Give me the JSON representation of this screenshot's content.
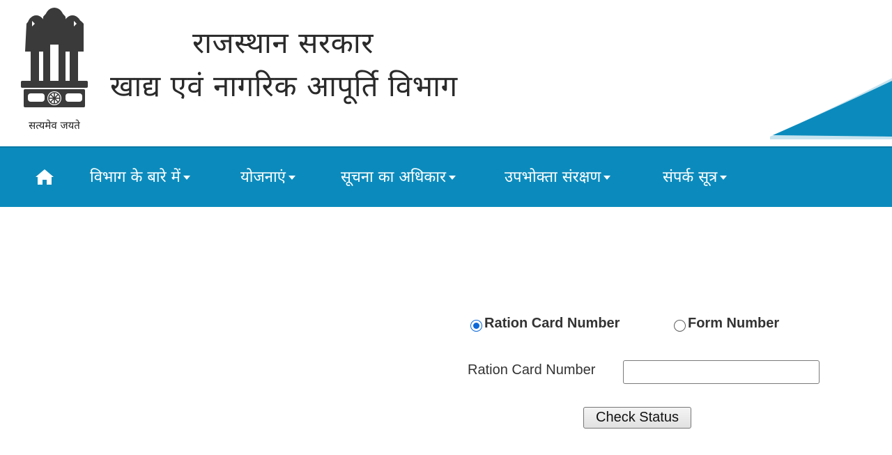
{
  "header": {
    "title_line1": "राजस्थान सरकार",
    "title_line2": "खाद्य एवं नागरिक आपूर्ति विभाग",
    "motto": "सत्यमेव जयते",
    "emblem_icon": "ashoka-emblem-icon"
  },
  "nav": {
    "home_icon": "home-icon",
    "items": [
      {
        "label": "विभाग के बारे में",
        "has_dropdown": true
      },
      {
        "label": "योजनाएं",
        "has_dropdown": true
      },
      {
        "label": "सूचना का अधिकार",
        "has_dropdown": true
      },
      {
        "label": "उपभोक्ता संरक्षण",
        "has_dropdown": true
      },
      {
        "label": "संपर्क सूत्र",
        "has_dropdown": true
      }
    ]
  },
  "form": {
    "options": [
      {
        "label": "Ration Card Number",
        "selected": true
      },
      {
        "label": "Form Number",
        "selected": false
      }
    ],
    "field_label": "Ration Card Number",
    "field_value": "",
    "field_placeholder": "",
    "submit_label": "Check Status"
  },
  "colors": {
    "nav_background": "#0b8bbd",
    "nav_text": "#ffffff",
    "radio_selected": "#0b68d8",
    "corner_decoration": "#0b8bbd"
  }
}
